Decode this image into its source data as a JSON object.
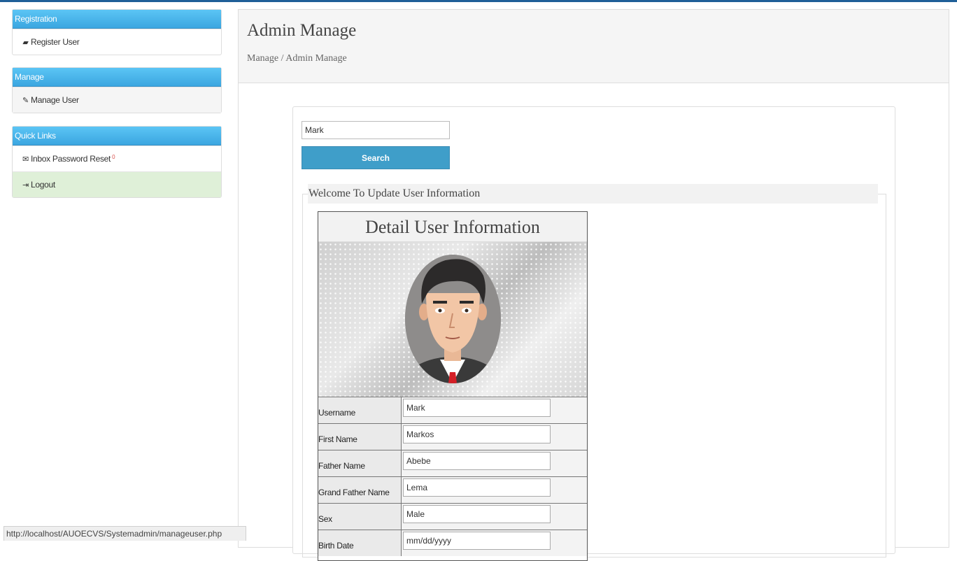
{
  "sidebar": {
    "registration": {
      "title": "Registration",
      "items": [
        {
          "label": "Register User",
          "icon": "folder-open-icon"
        }
      ]
    },
    "manage": {
      "title": "Manage",
      "items": [
        {
          "label": "Manage User",
          "icon": "edit-icon"
        }
      ]
    },
    "quick_links": {
      "title": "Quick Links",
      "items": [
        {
          "label": "Inbox Password Reset",
          "icon": "envelope-icon",
          "badge": "0"
        },
        {
          "label": "Logout",
          "icon": "logout-icon"
        }
      ]
    }
  },
  "main": {
    "title": "Admin Manage",
    "breadcrumb": "Manage / Admin Manage"
  },
  "search": {
    "value": "Mark",
    "button_label": "Search"
  },
  "update_section": {
    "legend": "Welcome To Update User Information"
  },
  "detail": {
    "title": "Detail User Information",
    "fields": [
      {
        "label": "Username",
        "value": "Mark"
      },
      {
        "label": "First Name",
        "value": "Markos"
      },
      {
        "label": "Father Name",
        "value": "Abebe"
      },
      {
        "label": "Grand Father Name",
        "value": "Lema"
      },
      {
        "label": "Sex",
        "value": "Male"
      },
      {
        "label": "Birth Date",
        "value": "mm/dd/yyyy"
      }
    ]
  },
  "status_bar": {
    "url": "http://localhost/AUOECVS/Systemadmin/manageuser.php"
  },
  "colors": {
    "panel_header": "#3ba6e0",
    "search_button": "#3f9ec9",
    "logout_bg": "#dff0d8",
    "top_bar": "#1f5f98"
  }
}
